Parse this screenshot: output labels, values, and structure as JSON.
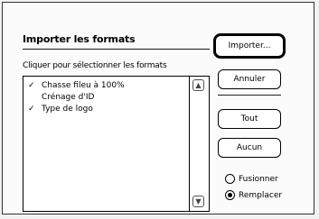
{
  "dialog": {
    "title": "Importer les formats",
    "instructions": "Cliquer pour sélectionner les formats"
  },
  "list": {
    "items": [
      {
        "checked": true,
        "check_mark": "✓",
        "label": "Chasse fileu à 100%"
      },
      {
        "checked": false,
        "check_mark": "",
        "label": "Crénage d'ID"
      },
      {
        "checked": true,
        "check_mark": "✓",
        "label": "Type de logo"
      }
    ],
    "scroll_up_icon": "up-arrow-icon",
    "scroll_down_icon": "down-arrow-icon"
  },
  "buttons": {
    "import": "Importer...",
    "cancel": "Annuler",
    "all": "Tout",
    "none": "Aucun"
  },
  "options": {
    "merge": {
      "label": "Fusionner",
      "selected": false
    },
    "replace": {
      "label": "Remplacer",
      "selected": true
    }
  }
}
